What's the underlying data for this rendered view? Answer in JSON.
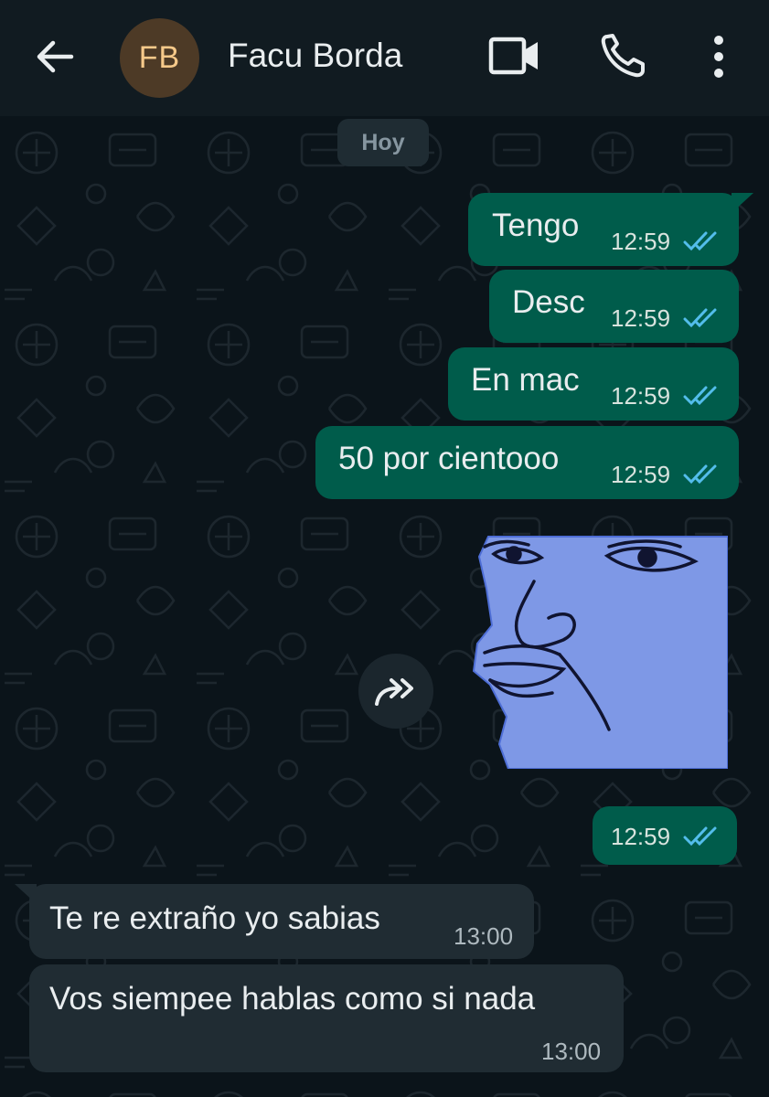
{
  "header": {
    "back_icon": "arrow-left-icon",
    "avatar_initials": "FB",
    "contact_name": "Facu Borda",
    "video_icon": "video-call-icon",
    "phone_icon": "phone-icon",
    "menu_icon": "more-vertical-icon"
  },
  "chat": {
    "date_chip": "Hoy",
    "messages": [
      {
        "direction": "out",
        "text": "Tengo",
        "time": "12:59",
        "status": "read"
      },
      {
        "direction": "out",
        "text": "Desc",
        "time": "12:59",
        "status": "read"
      },
      {
        "direction": "out",
        "text": "En mac",
        "time": "12:59",
        "status": "read"
      },
      {
        "direction": "out",
        "text": "50 por cientooo",
        "time": "12:59",
        "status": "read"
      },
      {
        "direction": "out",
        "type": "sticker",
        "time": "12:59",
        "status": "read"
      },
      {
        "direction": "in",
        "text": "Te re extraño yo sabias",
        "time": "13:00"
      },
      {
        "direction": "in",
        "text": "Vos siempee hablas como si nada",
        "time": "13:00"
      }
    ],
    "forward_icon": "forward-icon",
    "read_tick_color": "#53bdeb"
  },
  "colors": {
    "outgoing_bubble": "#005c4b",
    "incoming_bubble": "#202c33",
    "background": "#0b141a",
    "header": "#111b21"
  }
}
